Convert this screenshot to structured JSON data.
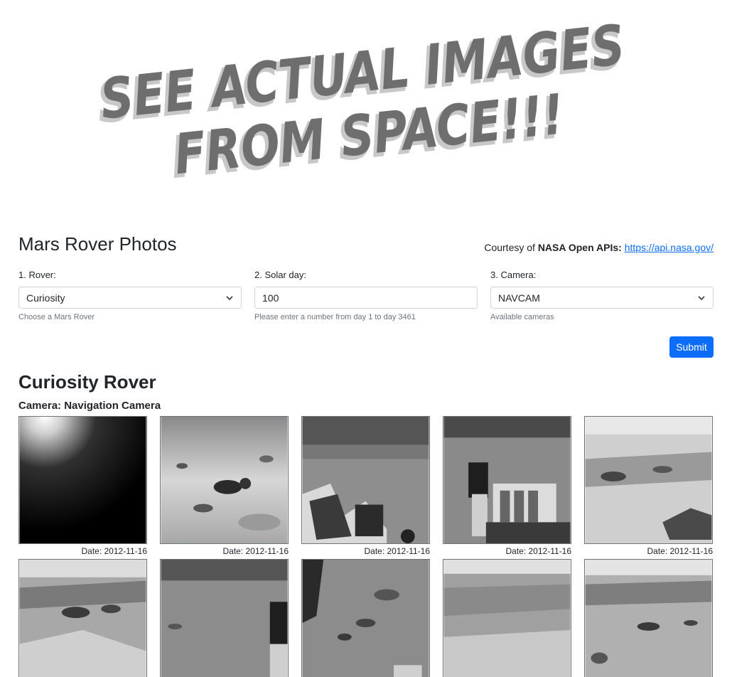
{
  "banner": {
    "line1": "SEE ACTUAL IMAGES",
    "line2": "FROM SPACE!!!"
  },
  "header": {
    "title": "Mars Rover Photos",
    "courtesy_prefix": "Courtesy of ",
    "courtesy_bold": "NASA Open APIs:",
    "courtesy_link": "https://api.nasa.gov/"
  },
  "form": {
    "rover": {
      "label": "1. Rover:",
      "value": "Curiosity",
      "help": "Choose a Mars Rover"
    },
    "sol": {
      "label": "2. Solar day:",
      "value": "100",
      "help": "Please enter a number from day 1 to day 3461"
    },
    "camera": {
      "label": "3. Camera:",
      "value": "NAVCAM",
      "help": "Available cameras"
    },
    "submit_label": "Submit"
  },
  "results": {
    "rover_title": "Curiosity Rover",
    "camera_title": "Camera: Navigation Camera",
    "photos": [
      {
        "date": "Date: 2012-11-16"
      },
      {
        "date": "Date: 2012-11-16"
      },
      {
        "date": "Date: 2012-11-16"
      },
      {
        "date": "Date: 2012-11-16"
      },
      {
        "date": "Date: 2012-11-16"
      },
      {
        "date": ""
      },
      {
        "date": ""
      },
      {
        "date": ""
      },
      {
        "date": ""
      },
      {
        "date": ""
      }
    ]
  },
  "colors": {
    "accent": "#0d6efd",
    "text": "#212529",
    "muted": "#6c757d"
  }
}
